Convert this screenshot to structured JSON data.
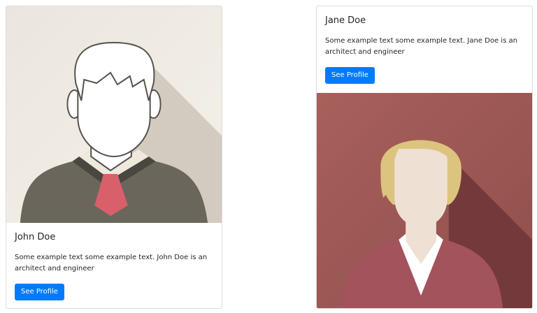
{
  "cards": [
    {
      "title": "John Doe",
      "text": "Some example text some example text. John Doe is an architect and engineer",
      "button_label": "See Profile",
      "image": "male-avatar-illustration"
    },
    {
      "title": "Jane Doe",
      "text": "Some example text some example text. Jane Doe is an architect and engineer",
      "button_label": "See Profile",
      "image": "female-avatar-illustration"
    }
  ],
  "colors": {
    "button": "#007bff",
    "john_bg": "#efebe4",
    "jane_bg": "#a4605c"
  }
}
